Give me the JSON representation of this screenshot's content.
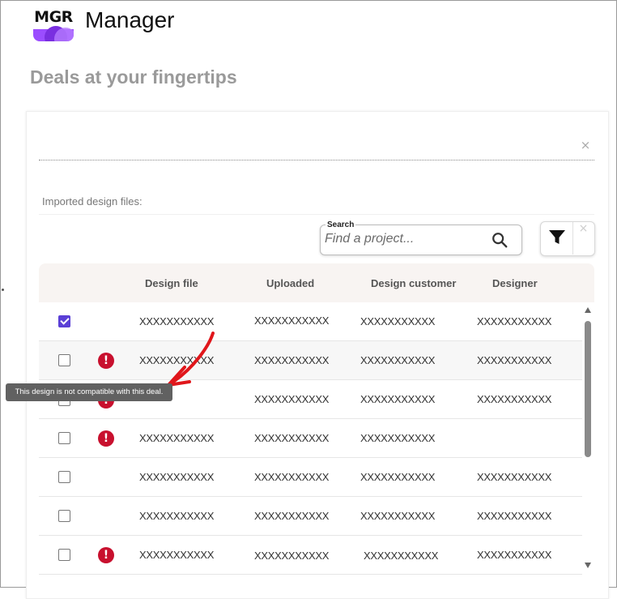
{
  "app": {
    "logo_text": "MGR",
    "title": "Manager"
  },
  "page": {
    "heading": "Deals at your fingertips"
  },
  "dialog": {
    "close_icon": "×",
    "imported_label": "Imported design files:"
  },
  "search": {
    "label": "Search",
    "placeholder": "Find a project...",
    "value": ""
  },
  "filter": {
    "filter_icon": "funnel-icon",
    "clear_icon": "×"
  },
  "table": {
    "columns": [
      "Design file",
      "Uploaded",
      "Design customer",
      "Designer"
    ],
    "rows": [
      {
        "checked": true,
        "error": false,
        "design_file": "XXXXXXXXXXX",
        "uploaded": "XXXXXXXXXXX",
        "customer": "XXXXXXXXXXX",
        "designer": "XXXXXXXXXXX"
      },
      {
        "checked": false,
        "error": true,
        "design_file": "XXXXXXXXXXX",
        "uploaded": "XXXXXXXXXXX",
        "customer": "XXXXXXXXXXX",
        "designer": "XXXXXXXXXXX"
      },
      {
        "checked": false,
        "error": true,
        "design_file": "",
        "uploaded": "XXXXXXXXXXX",
        "customer": "XXXXXXXXXXX",
        "designer": "XXXXXXXXXXX"
      },
      {
        "checked": false,
        "error": true,
        "design_file": "XXXXXXXXXXX",
        "uploaded": "XXXXXXXXXXX",
        "customer": "XXXXXXXXXXX",
        "designer": ""
      },
      {
        "checked": false,
        "error": false,
        "design_file": "XXXXXXXXXXX",
        "uploaded": "XXXXXXXXXXX",
        "customer": "XXXXXXXXXXX",
        "designer": "XXXXXXXXXXX"
      },
      {
        "checked": false,
        "error": false,
        "design_file": "XXXXXXXXXXX",
        "uploaded": "XXXXXXXXXXX",
        "customer": "XXXXXXXXXXX",
        "designer": "XXXXXXXXXXX"
      },
      {
        "checked": false,
        "error": true,
        "design_file": "XXXXXXXXXXX",
        "uploaded": "XXXXXXXXXXX",
        "customer": "XXXXXXXXXXX",
        "designer": "XXXXXXXXXXX"
      }
    ],
    "error_icon_glyph": "!"
  },
  "tooltip": {
    "text": "This design is not compatible with this deal."
  },
  "colors": {
    "accent": "#5a3fd6",
    "logo_purple": "#9b4dff",
    "error_red": "#c8102e",
    "annotation_red": "#e0161b",
    "header_bg": "#f8f4f2"
  }
}
